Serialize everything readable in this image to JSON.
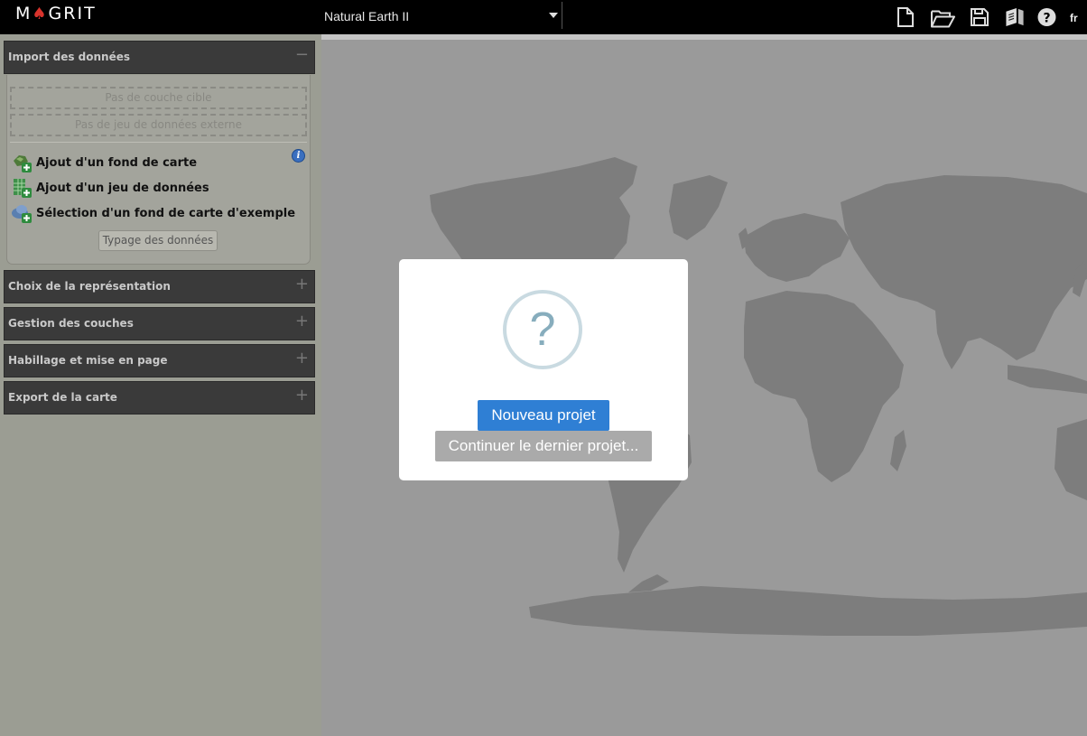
{
  "app": {
    "logo_left": "M",
    "logo_o": "♠",
    "logo_right": "GRIT"
  },
  "toolbar": {
    "basemap_value": "Natural Earth II",
    "icons": [
      "new-file-icon",
      "open-folder-icon",
      "save-icon",
      "book-icon",
      "help-icon"
    ],
    "language": "fr"
  },
  "sidebar": {
    "import": {
      "title": "Import des données",
      "toggle": "−",
      "target_layer_placeholder": "Pas de couche cible",
      "external_dataset_placeholder": "Pas de jeu de données externe",
      "actions": [
        {
          "label": "Ajout d'un fond de carte",
          "icon": "add-basemap-icon"
        },
        {
          "label": "Ajout d'un jeu de données",
          "icon": "add-dataset-icon"
        },
        {
          "label": "Sélection d'un fond de carte d'exemple",
          "icon": "add-sample-basemap-icon"
        }
      ],
      "info": "i",
      "typing_button": "Typage des données"
    },
    "sections": [
      {
        "title": "Choix de la représentation",
        "toggle": "+"
      },
      {
        "title": "Gestion des couches",
        "toggle": "+"
      },
      {
        "title": "Habillage et mise en page",
        "toggle": "+"
      },
      {
        "title": "Export de la carte",
        "toggle": "+"
      }
    ]
  },
  "modal": {
    "icon_char": "?",
    "new_project": "Nouveau projet",
    "continue_project": "Continuer le dernier projet..."
  },
  "colors": {
    "topbar": "#000000",
    "sidebar_bg": "#9b9d93",
    "section_header": "#3a3a3a",
    "map_bg": "#9a9a9a",
    "land": "#7c7c7c",
    "primary_button": "#2f7fd4",
    "secondary_button": "#aaaaaa",
    "logo_accent": "#d9332c"
  }
}
